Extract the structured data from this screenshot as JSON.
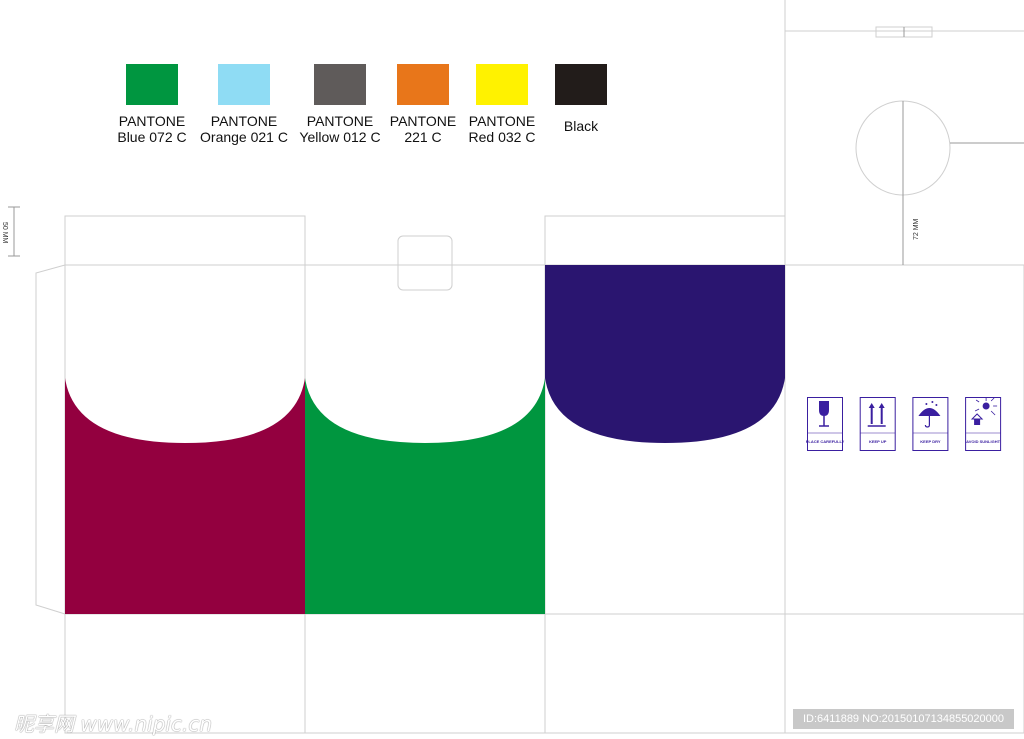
{
  "swatches": [
    {
      "color": "#009640",
      "line1": "PANTONE",
      "line2": "Blue 072 C"
    },
    {
      "color": "#8fdcf4",
      "line1": "PANTONE",
      "line2": "Orange 021 C"
    },
    {
      "color": "#5f5b5a",
      "line1": "PANTONE",
      "line2": "Yellow 012 C"
    },
    {
      "color": "#e8761a",
      "line1": "PANTONE",
      "line2": "221 C"
    },
    {
      "color": "#fff200",
      "line1": "PANTONE",
      "line2": "Red 032 C"
    },
    {
      "color": "#221c1a",
      "line1": "",
      "line2": "Black"
    }
  ],
  "panels": {
    "panel1_color": "#93003f",
    "panel2_color": "#00963f",
    "panel3_color": "#2a1570"
  },
  "dimensions": {
    "left": "50 MM",
    "right": "72 MM"
  },
  "handling_icons": [
    {
      "icon": "wine-glass-icon",
      "label": "PLACE CAREFULLY"
    },
    {
      "icon": "arrows-up-icon",
      "label": "KEEP UP"
    },
    {
      "icon": "umbrella-icon",
      "label": "KEEP DRY"
    },
    {
      "icon": "sun-icon",
      "label": "AVOID SUNLIGHT"
    }
  ],
  "icon_color": "#3a1fa0",
  "watermark": {
    "site": "昵享网 www.nipic.cn",
    "id": "ID:6411889 NO:20150107134855020000"
  }
}
